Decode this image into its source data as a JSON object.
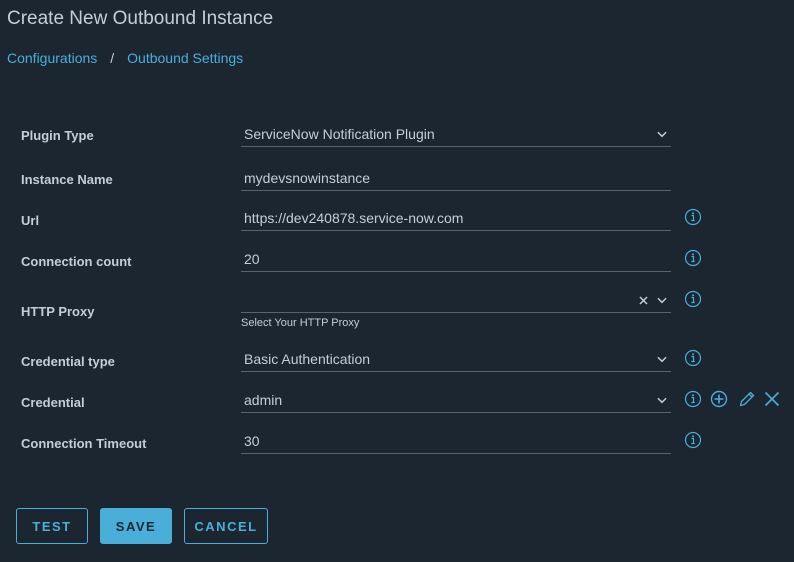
{
  "header": {
    "title": "Create New Outbound Instance",
    "breadcrumb": [
      {
        "label": "Configurations"
      },
      {
        "label": "Outbound Settings"
      }
    ],
    "breadcrumb_separator": "/"
  },
  "form": {
    "plugin_type": {
      "label": "Plugin Type",
      "value": "ServiceNow Notification Plugin",
      "type": "select"
    },
    "instance_name": {
      "label": "Instance Name",
      "value": "mydevsnowinstance",
      "type": "text"
    },
    "url": {
      "label": "Url",
      "value": "https://dev240878.service-now.com",
      "type": "text",
      "info_icon": "info-icon"
    },
    "connection_count": {
      "label": "Connection count",
      "value": "20",
      "type": "text",
      "info_icon": "info-icon"
    },
    "http_proxy": {
      "label": "HTTP Proxy",
      "value": "",
      "helper": "Select Your HTTP Proxy",
      "type": "select-clearable",
      "info_icon": "info-icon"
    },
    "credential_type": {
      "label": "Credential type",
      "value": "Basic Authentication",
      "type": "select",
      "info_icon": "info-icon"
    },
    "credential": {
      "label": "Credential",
      "value": "admin",
      "type": "select",
      "icons": [
        "info-icon",
        "add-icon",
        "edit-icon",
        "remove-icon"
      ]
    },
    "connection_timeout": {
      "label": "Connection Timeout",
      "value": "30",
      "type": "text",
      "info_icon": "info-icon"
    }
  },
  "actions": {
    "test": "TEST",
    "save": "SAVE",
    "cancel": "CANCEL"
  },
  "colors": {
    "background": "#1b2631",
    "accent": "#49afd9",
    "text": "#c6ced5",
    "underline": "#566470"
  }
}
